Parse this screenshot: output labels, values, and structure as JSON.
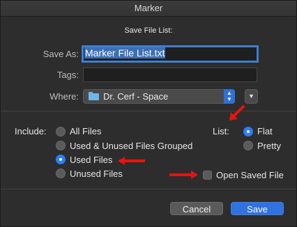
{
  "window": {
    "title": "Marker"
  },
  "dialog": {
    "title": "Save File List:",
    "save_as": {
      "label": "Save As:",
      "value": "Marker File List.txt"
    },
    "tags": {
      "label": "Tags:",
      "value": ""
    },
    "where": {
      "label": "Where:",
      "value": "Dr. Cerf - Space"
    }
  },
  "include": {
    "label": "Include:",
    "options": [
      "All Files",
      "Used & Unused Files Grouped",
      "Used Files",
      "Unused Files"
    ],
    "selected": "Used Files"
  },
  "list": {
    "label": "List:",
    "options": [
      "Flat",
      "Pretty"
    ],
    "selected": "Flat"
  },
  "open_saved_file": {
    "label": "Open Saved File",
    "checked": false
  },
  "buttons": {
    "cancel": "Cancel",
    "save": "Save"
  },
  "colors": {
    "accent": "#2f7cf6",
    "annotation_arrow": "#e6140f",
    "folder": "#6fb6ea"
  },
  "icons": {
    "folder": "folder-icon",
    "stepper": "up-down-chevron-icon",
    "expand": "chevron-down-icon"
  }
}
